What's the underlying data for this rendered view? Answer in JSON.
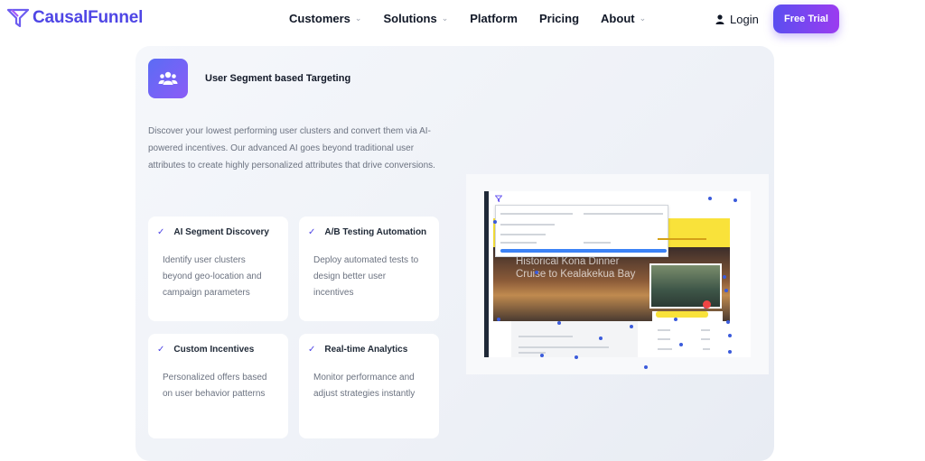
{
  "nav": {
    "brand": "CausalFunnel",
    "items": [
      {
        "label": "Customers",
        "has_dropdown": true
      },
      {
        "label": "Solutions",
        "has_dropdown": true
      },
      {
        "label": "Platform",
        "has_dropdown": false
      },
      {
        "label": "Pricing",
        "has_dropdown": false
      },
      {
        "label": "About",
        "has_dropdown": true
      }
    ],
    "login": "Login",
    "free_trial": "Free Trial"
  },
  "card": {
    "title": "User Segment based Targeting",
    "description": "Discover your lowest performing user clusters and convert them via AI-powered incentives. Our advanced AI goes beyond traditional user attributes to create highly personalized attributes that drive conversions.",
    "features": [
      {
        "title": "AI Segment Discovery",
        "description": "Identify user clusters beyond geo-location and campaign parameters"
      },
      {
        "title": "A/B Testing Automation",
        "description": "Deploy automated tests to design better user incentives"
      },
      {
        "title": "Custom Incentives",
        "description": "Personalized offers based on user behavior patterns"
      },
      {
        "title": "Real-time Analytics",
        "description": "Monitor performance and adjust strategies instantly"
      }
    ]
  },
  "preview": {
    "hero_title": "Historical Kona Dinner Cruise to Kealakekua Bay"
  },
  "colors": {
    "brand": "#4f46e5",
    "accent_gradient_start": "#5b4ef0",
    "accent_gradient_end": "#9b3cf0",
    "check": "#4f46e5"
  }
}
